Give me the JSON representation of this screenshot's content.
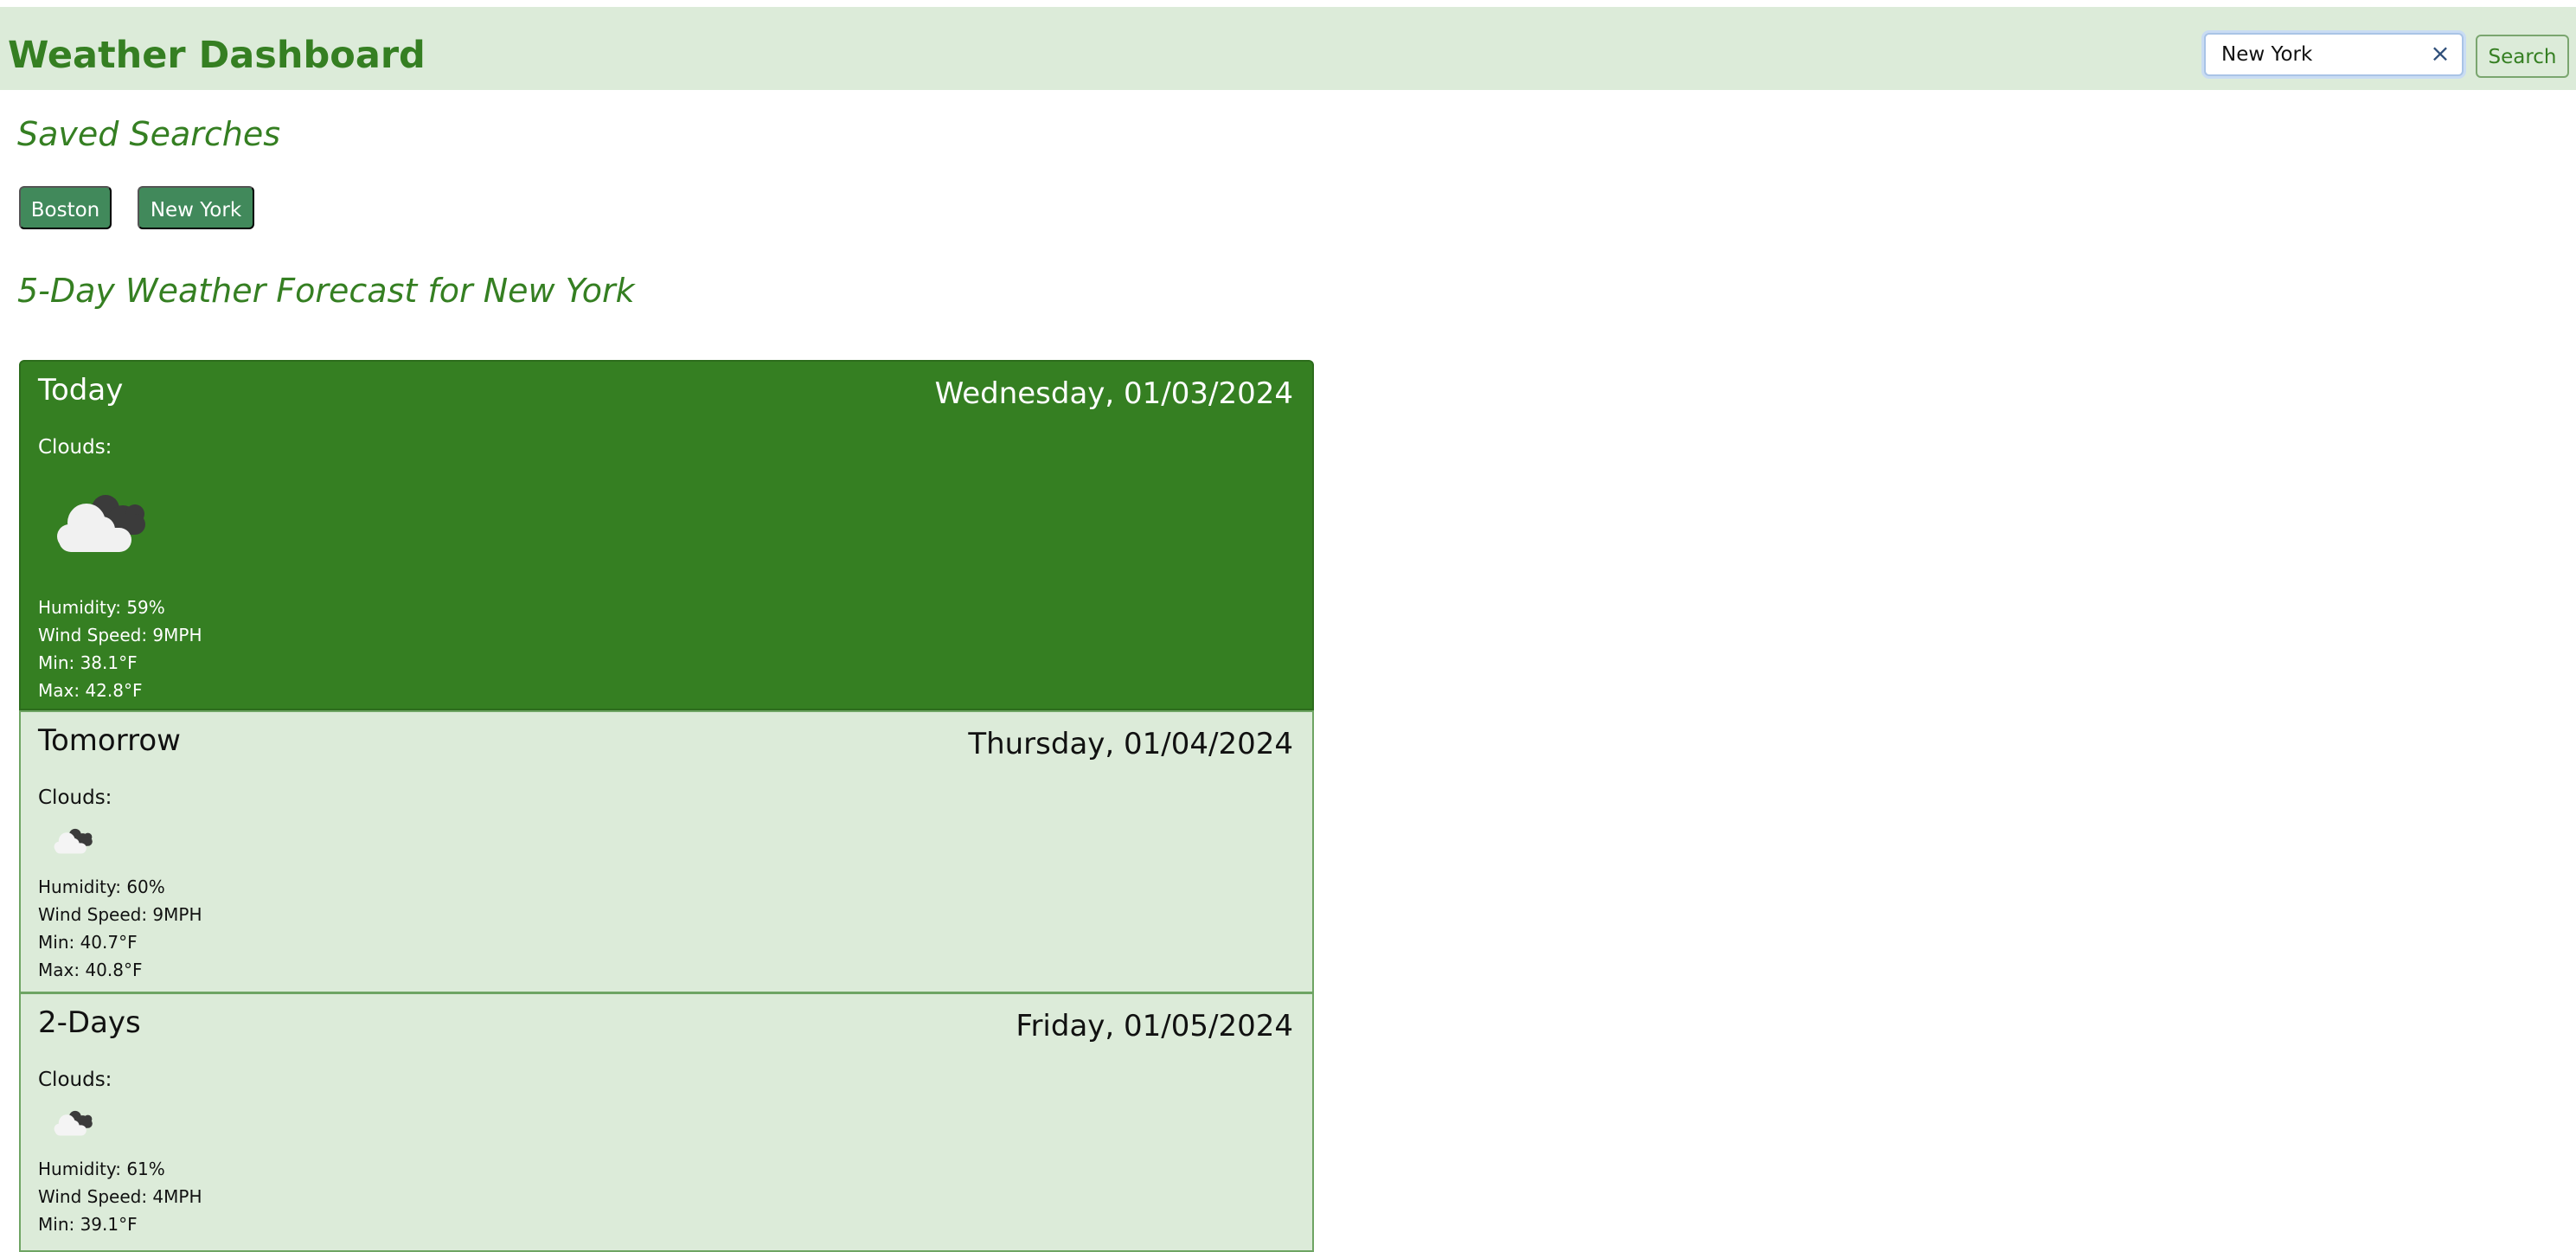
{
  "header": {
    "title": "Weather Dashboard",
    "search_value": "New York",
    "clear_icon": "×",
    "search_button": "Search"
  },
  "saved": {
    "heading": "Saved Searches",
    "cities": [
      "Boston",
      "New York"
    ]
  },
  "forecast": {
    "heading": "5-Day Weather Forecast for New York",
    "days": [
      {
        "label": "Today",
        "date": "Wednesday, 01/03/2024",
        "condition": "Clouds:",
        "icon": "cloud-icon",
        "humidity": "Humidity: 59%",
        "wind": "Wind Speed: 9MPH",
        "min": "Min: 38.1°F",
        "max": "Max: 42.8°F"
      },
      {
        "label": "Tomorrow",
        "date": "Thursday, 01/04/2024",
        "condition": "Clouds:",
        "icon": "cloud-icon",
        "humidity": "Humidity: 60%",
        "wind": "Wind Speed: 9MPH",
        "min": "Min: 40.7°F",
        "max": "Max: 40.8°F"
      },
      {
        "label": "2-Days",
        "date": "Friday, 01/05/2024",
        "condition": "Clouds:",
        "icon": "cloud-icon",
        "humidity": "Humidity: 61%",
        "wind": "Wind Speed: 4MPH",
        "min": "Min: 39.1°F",
        "max": ""
      }
    ]
  },
  "colors": {
    "primary_green": "#357f22",
    "light_green": "#dcebd9",
    "city_button": "#41895b"
  }
}
